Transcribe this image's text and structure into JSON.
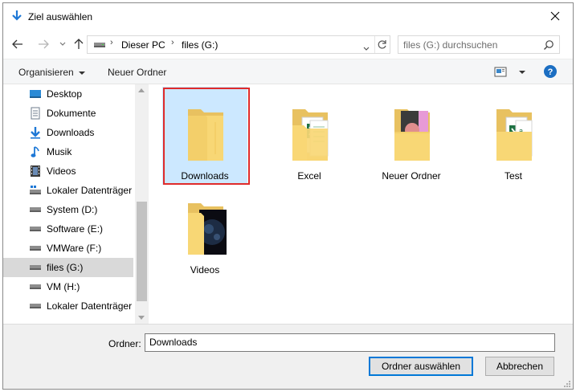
{
  "window": {
    "title": "Ziel auswählen"
  },
  "nav": {
    "breadcrumb": [
      "Dieser PC",
      "files (G:)"
    ],
    "search_placeholder": "files (G:) durchsuchen"
  },
  "commands": {
    "organize": "Organisieren",
    "new_folder": "Neuer Ordner"
  },
  "sidebar": {
    "items": [
      {
        "label": "Desktop",
        "icon": "desktop-icon"
      },
      {
        "label": "Dokumente",
        "icon": "documents-icon"
      },
      {
        "label": "Downloads",
        "icon": "downloads-icon"
      },
      {
        "label": "Musik",
        "icon": "music-icon"
      },
      {
        "label": "Videos",
        "icon": "videos-icon"
      },
      {
        "label": "Lokaler Datenträger (",
        "icon": "local-disk-icon"
      },
      {
        "label": "System (D:)",
        "icon": "drive-icon"
      },
      {
        "label": "Software (E:)",
        "icon": "drive-icon"
      },
      {
        "label": "VMWare (F:)",
        "icon": "drive-icon"
      },
      {
        "label": "files (G:)",
        "icon": "drive-icon",
        "selected": true
      },
      {
        "label": "VM (H:)",
        "icon": "drive-icon"
      },
      {
        "label": "Lokaler Datenträger (",
        "icon": "local-disk-icon"
      }
    ]
  },
  "folders": [
    {
      "name": "Downloads",
      "selected": true
    },
    {
      "name": "Excel"
    },
    {
      "name": "Neuer Ordner"
    },
    {
      "name": "Test"
    },
    {
      "name": "Videos"
    }
  ],
  "footer": {
    "folder_label": "Ordner:",
    "folder_value": "Downloads",
    "select_button": "Ordner auswählen",
    "cancel_button": "Abbrechen"
  },
  "colors": {
    "accent": "#0078d7",
    "selection": "#cce8ff",
    "highlight_box": "#e02b2b",
    "folder": "#f8d775"
  }
}
